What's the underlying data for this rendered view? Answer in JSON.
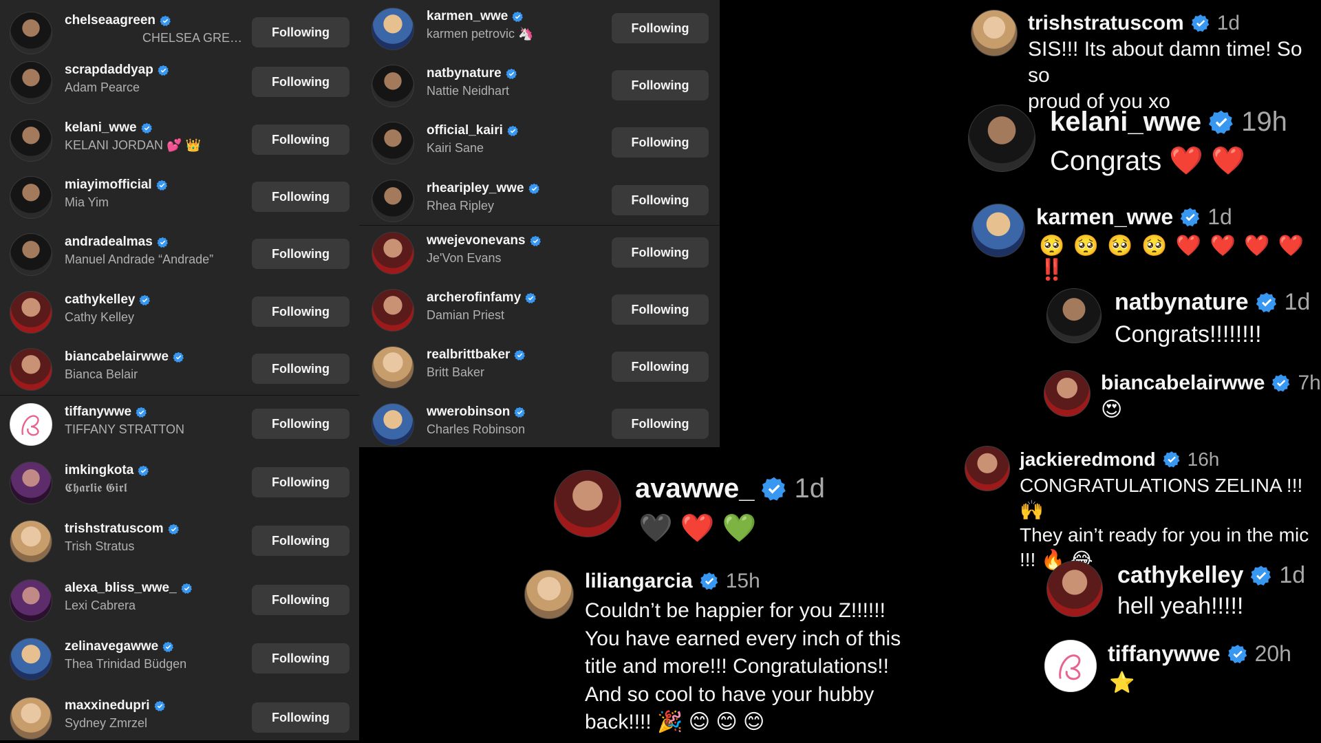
{
  "left_list": [
    {
      "username": "chelseaagreen",
      "name": "CHELSEA GRE…",
      "button": "Following"
    },
    {
      "username": "scrapdaddyap",
      "name": "Adam Pearce",
      "button": "Following"
    },
    {
      "username": "kelani_wwe",
      "name": "KELANI JORDAN 💕 👑",
      "button": "Following"
    },
    {
      "username": "miayimofficial",
      "name": "Mia Yim",
      "button": "Following"
    },
    {
      "username": "andradealmas",
      "name": "Manuel Andrade “Andrade”",
      "button": "Following"
    },
    {
      "username": "cathykelley",
      "name": "Cathy Kelley",
      "button": "Following"
    },
    {
      "username": "biancabelairwwe",
      "name": "Bianca Belair",
      "button": "Following"
    },
    {
      "username": "tiffanywwe",
      "name": "TIFFANY STRATTON",
      "button": "Following"
    },
    {
      "username": "imkingkota",
      "name": "𝕮𝖍𝖆𝖗𝖑𝖎𝖊 𝕲𝖎𝖗𝖑",
      "button": "Following"
    },
    {
      "username": "trishstratuscom",
      "name": "Trish Stratus",
      "button": "Following"
    },
    {
      "username": "alexa_bliss_wwe_",
      "name": "Lexi Cabrera",
      "button": "Following"
    },
    {
      "username": "zelinavegawwe",
      "name": "Thea Trinidad Büdgen",
      "button": "Following"
    },
    {
      "username": "maxxinedupri",
      "name": "Sydney Zmrzel",
      "button": "Following"
    }
  ],
  "middle_list": [
    {
      "username": "karmen_wwe",
      "name": "karmen petrovic 🦄",
      "button": "Following"
    },
    {
      "username": "natbynature",
      "name": "Nattie Neidhart",
      "button": "Following"
    },
    {
      "username": "official_kairi",
      "name": "Kairi Sane",
      "button": "Following"
    },
    {
      "username": "rhearipley_wwe",
      "name": "Rhea Ripley",
      "button": "Following"
    },
    {
      "username": "wwejevonevans",
      "name": "Je'Von Evans",
      "button": "Following"
    },
    {
      "username": "archerofinfamy",
      "name": "Damian Priest",
      "button": "Following"
    },
    {
      "username": "realbrittbaker",
      "name": "Britt Baker",
      "button": "Following"
    },
    {
      "username": "wwerobinson",
      "name": "Charles Robinson",
      "button": "Following"
    }
  ],
  "comments_center": [
    {
      "username": "avawwe_",
      "time": "1d",
      "text": "🖤 ❤️ 💚"
    },
    {
      "username": "liliangarcia",
      "time": "15h",
      "lines": [
        "Couldn’t be happier for you Z!!!!!!",
        "You have earned every inch of this",
        "title and more!!! Congratulations!!",
        "And so cool to have your hubby",
        "back!!!! 🎉 😊 😊 😊"
      ]
    }
  ],
  "comments_right": [
    {
      "username": "trishstratuscom",
      "time": "1d",
      "lines": [
        "SIS!!! Its about damn time! So so",
        "proud of you xo"
      ]
    },
    {
      "username": "kelani_wwe",
      "time": "19h",
      "lines": [
        "Congrats ❤️ ❤️"
      ]
    },
    {
      "username": "karmen_wwe",
      "time": "1d",
      "lines": [
        "🥺 🥺 🥺 🥺 ❤️ ❤️ ❤️ ❤️ ‼️"
      ]
    },
    {
      "username": "natbynature",
      "time": "1d",
      "lines": [
        "Congrats!!!!!!!!"
      ]
    },
    {
      "username": "biancabelairwwe",
      "time": "7h",
      "lines": [
        "😍"
      ]
    },
    {
      "username": "jackieredmond",
      "time": "16h",
      "lines": [
        "CONGRATULATIONS ZELINA !!! 🙌",
        "They ain’t ready for you in the mic",
        "!!! 🔥 😂"
      ]
    },
    {
      "username": "cathykelley",
      "time": "1d",
      "lines": [
        "hell yeah!!!!!"
      ]
    },
    {
      "username": "tiffanywwe",
      "time": "20h",
      "lines": [
        "⭐"
      ]
    }
  ],
  "colors": {
    "panel": "#262626",
    "background": "#000000",
    "verified": "#3897f0",
    "button": "#3a3a3a"
  }
}
